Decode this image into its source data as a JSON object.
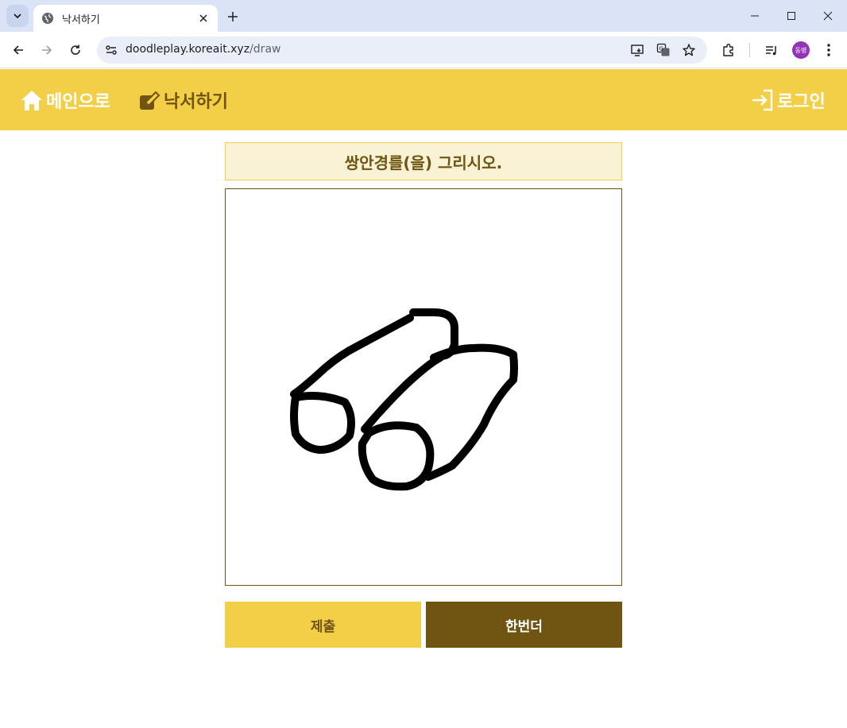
{
  "browser": {
    "tab_title": "낙서하기",
    "url_host": "doodleplay.koreait.xyz",
    "url_path": "/draw",
    "profile_label": "동병"
  },
  "header": {
    "home_label": "메인으로",
    "draw_label": "낙서하기",
    "login_label": "로그인"
  },
  "main": {
    "prompt": "쌍안경를(을) 그리시오.",
    "submit_label": "제출",
    "retry_label": "한번더"
  },
  "colors": {
    "header_bg": "#f2cf47",
    "brown": "#6f5412",
    "prompt_bg": "#faf2d5"
  }
}
